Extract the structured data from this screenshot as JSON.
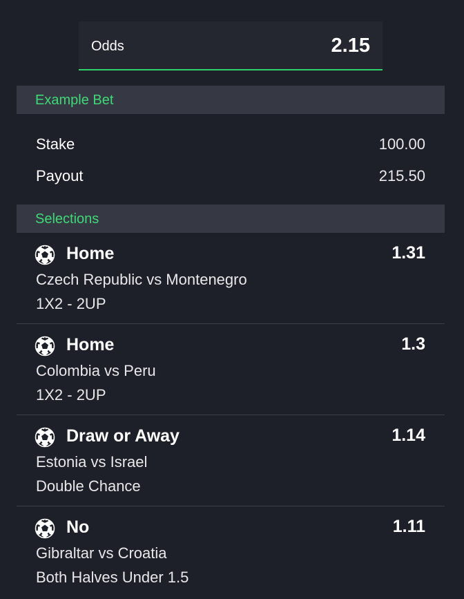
{
  "odds": {
    "label": "Odds",
    "value": "2.15"
  },
  "example_bet": {
    "header": "Example Bet",
    "stake_label": "Stake",
    "stake_value": "100.00",
    "payout_label": "Payout",
    "payout_value": "215.50"
  },
  "selections": {
    "header": "Selections",
    "items": [
      {
        "icon": "soccer-ball-icon",
        "pick": "Home",
        "odds": "1.31",
        "match": "Czech Republic vs Montenegro",
        "market": "1X2 - 2UP"
      },
      {
        "icon": "soccer-ball-icon",
        "pick": "Home",
        "odds": "1.3",
        "match": "Colombia vs Peru",
        "market": "1X2 - 2UP"
      },
      {
        "icon": "soccer-ball-icon",
        "pick": "Draw or Away",
        "odds": "1.14",
        "match": "Estonia vs Israel",
        "market": "Double Chance"
      },
      {
        "icon": "soccer-ball-icon",
        "pick": "No",
        "odds": "1.11",
        "match": "Gibraltar vs Croatia",
        "market": "Both Halves Under 1.5"
      }
    ]
  },
  "colors": {
    "background": "#1e2029",
    "section_header_bg": "#363944",
    "accent_green": "#3fd976",
    "divider": "#3a3d47"
  }
}
